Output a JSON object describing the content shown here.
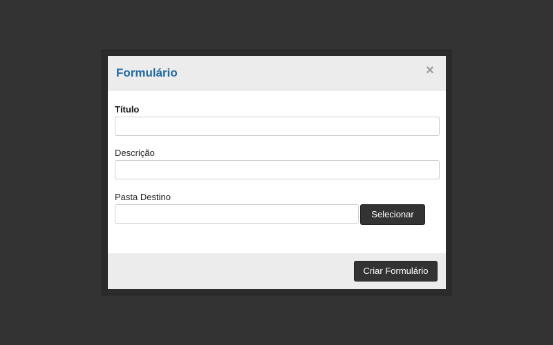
{
  "modal": {
    "title": "Formulário",
    "close_symbol": "×"
  },
  "form": {
    "title_field": {
      "label": "Título",
      "value": "",
      "placeholder": ""
    },
    "description_field": {
      "label": "Descrição",
      "value": "",
      "placeholder": ""
    },
    "destination_field": {
      "label": "Pasta Destino",
      "value": "",
      "placeholder": ""
    },
    "select_button_label": "Selecionar"
  },
  "footer": {
    "submit_label": "Criar Formulário"
  },
  "colors": {
    "backdrop": "#333333",
    "title_accent": "#1f6aa5",
    "button_bg": "#333333",
    "header_bg": "#ececec"
  }
}
